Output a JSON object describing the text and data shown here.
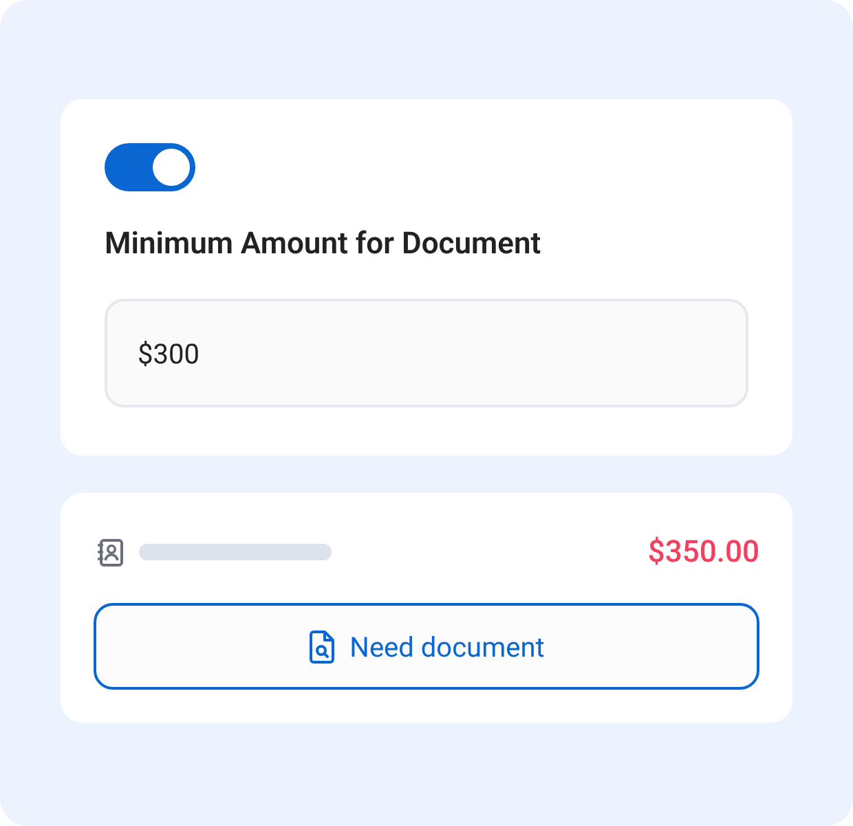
{
  "settings_card": {
    "toggle": {
      "on": true
    },
    "title": "Minimum Amount for Document",
    "amount_field": {
      "value": "$300"
    }
  },
  "entry_card": {
    "amount": "$350.00",
    "button": {
      "label": "Need document"
    }
  }
}
